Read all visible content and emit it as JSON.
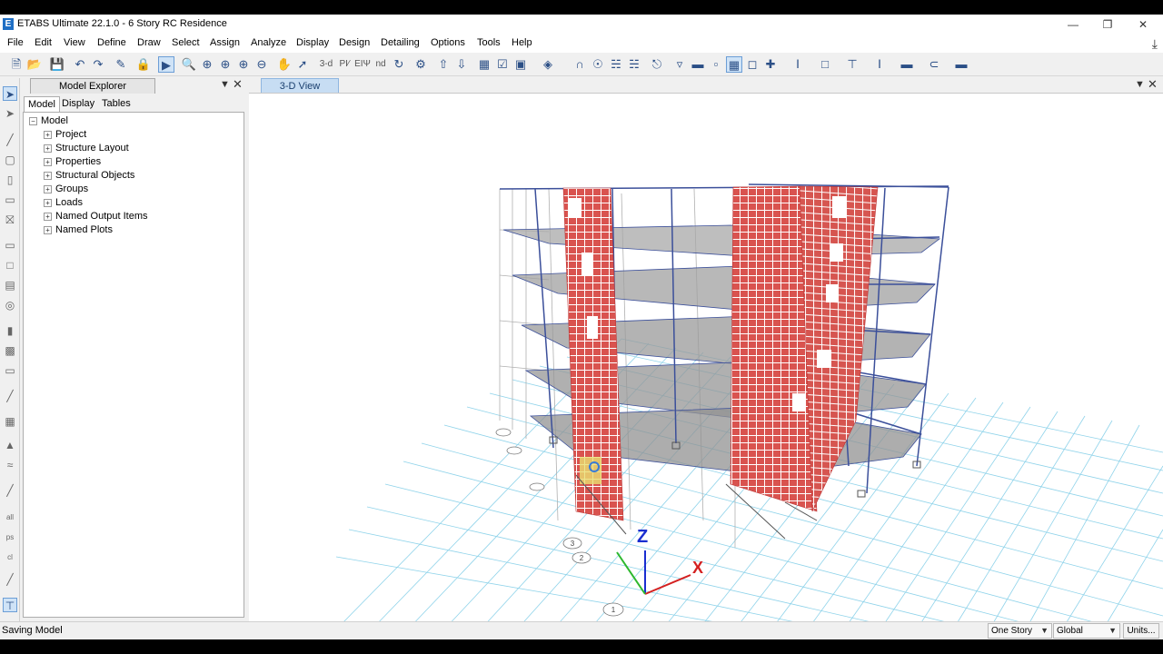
{
  "window": {
    "title": "ETABS Ultimate 22.1.0 - 6 Story RC Residence",
    "logo": "E"
  },
  "menu": [
    "File",
    "Edit",
    "View",
    "Define",
    "Draw",
    "Select",
    "Assign",
    "Analyze",
    "Display",
    "Design",
    "Detailing",
    "Options",
    "Tools",
    "Help"
  ],
  "toolbar": {
    "view_3d_label": "3-d",
    "plan_label": "ΡΙ∕",
    "elev_label": "ΕΙΨ",
    "nd_label": "nd"
  },
  "explorer": {
    "title": "Model Explorer",
    "tabs": [
      "Model",
      "Display",
      "Tables"
    ],
    "active_tab": "Model",
    "root": "Model",
    "items": [
      "Project",
      "Structure Layout",
      "Properties",
      "Structural Objects",
      "Groups",
      "Loads",
      "Named Output Items",
      "Named Plots"
    ]
  },
  "view": {
    "tab_label": "3-D View",
    "axes": {
      "z": "Z",
      "x": "X"
    },
    "grid_bubbles": [
      "3",
      "2",
      "1"
    ]
  },
  "status": {
    "message": "Saving Model",
    "story_option": "One Story",
    "coord_system": "Global",
    "units_label": "Units..."
  },
  "colors": {
    "accent": "#1f6fc5",
    "wall": "#d9534f",
    "frame": "#3b4f9a",
    "slab": "#9e9e9e",
    "grid": "#8fd3ea"
  }
}
